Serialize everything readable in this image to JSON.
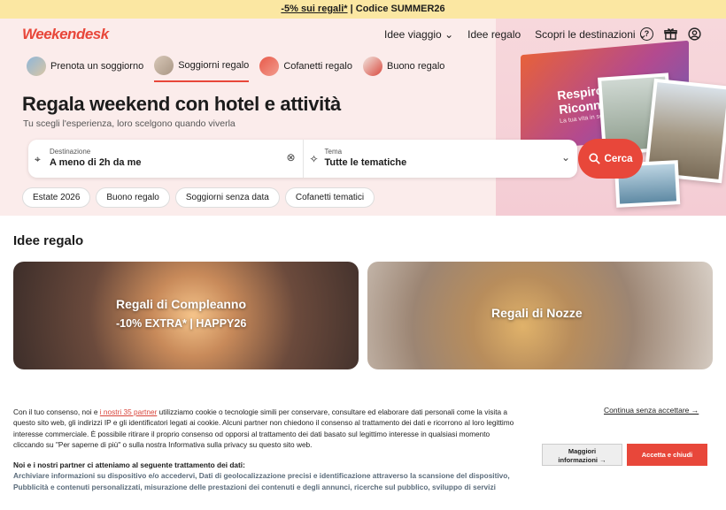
{
  "promo": {
    "link": "-5% sui regali*",
    "separator": " | ",
    "code": "Codice SUMMER26"
  },
  "logo": "Weekendesk",
  "nav": {
    "items": [
      "Idee viaggio",
      "Idee regalo",
      "Scopri le destinazioni"
    ]
  },
  "categories": [
    {
      "label": "Prenota un soggiorno"
    },
    {
      "label": "Soggiorni regalo"
    },
    {
      "label": "Cofanetti regalo"
    },
    {
      "label": "Buono regalo"
    }
  ],
  "hero": {
    "title": "Regala weekend con hotel e attività",
    "subtitle": "Tu scegli l'esperienza, loro scelgono quando viverla"
  },
  "search": {
    "destination_label": "Destinazione",
    "destination_value": "A meno di 2h da me",
    "theme_label": "Tema",
    "theme_value": "Tutte le tematiche",
    "button": "Cerca"
  },
  "chips": [
    "Estate 2026",
    "Buono regalo",
    "Soggiorni senza data",
    "Cofanetti tematici"
  ],
  "giftbox": {
    "title_line1": "Respiro",
    "title_line2": "Riconnessione",
    "tagline": "La tua vita in sospeso"
  },
  "section_title": "Idee regalo",
  "cards": [
    {
      "title": "Regali di Compleanno",
      "subtitle": "-10% EXTRA* | HAPPY26"
    },
    {
      "title": "Regali di Nozze"
    }
  ],
  "cookie": {
    "text_before": "Con il tuo consenso, noi e ",
    "link": "i nostri 35 partner",
    "text_after": " utilizziamo cookie o tecnologie simili per conservare, consultare ed elaborare dati personali come la visita a questo sito web, gli indirizzi IP e gli identificatori legati ai cookie. Alcuni partner non chiedono il consenso al trattamento dei dati e ricorrono al loro legittimo interesse commerciale. È possibile ritirare il proprio consenso od opporsi al trattamento dei dati basato sul legittimo interesse in qualsiasi momento cliccando su \"Per saperne di più\" o sulla nostra Informativa sulla privacy su questo sito web.",
    "purposes_heading": "Noi e i nostri partner ci atteniamo al seguente trattamento dei dati:",
    "purposes": "Archiviare informazioni su dispositivo e/o accedervi, Dati di geolocalizzazione precisi e identificazione attraverso la scansione del dispositivo, Pubblicità e contenuti personalizzati, misurazione delle prestazioni dei contenuti e degli annunci, ricerche sul pubblico, sviluppo di servizi",
    "continue": "Continua senza accettare →",
    "more_line1": "Maggiori",
    "more_line2": "informazioni →",
    "accept": "Accetta e chiudi"
  },
  "colors": {
    "brand": "#e8473a",
    "promo_bg": "#fbe7a2",
    "hero_bg": "#fbeceb"
  }
}
